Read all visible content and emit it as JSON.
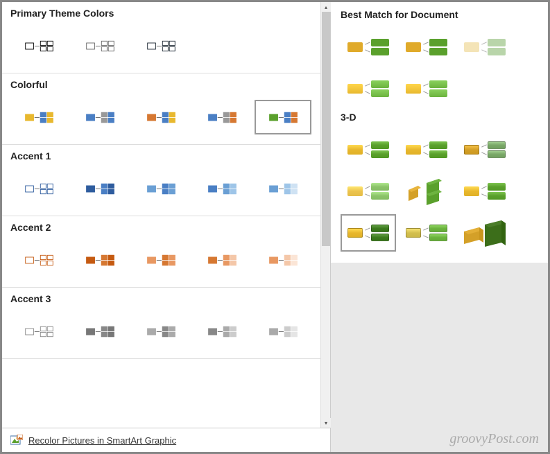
{
  "left_panel": {
    "sections": [
      {
        "id": "primary",
        "title": "Primary Theme Colors",
        "items": [
          {
            "c1": "#fff",
            "c2": "#fff",
            "c3": "#fff",
            "border": "#000"
          },
          {
            "c1": "#fff",
            "c2": "#333",
            "c3": "#fff",
            "border": "#666"
          },
          {
            "c1": "#2c3e50",
            "c2": "#34495e",
            "c3": "#2c3e50",
            "border": "#1a2530"
          }
        ]
      },
      {
        "id": "colorful",
        "title": "Colorful",
        "items": [
          {
            "c1": "#e8b82e",
            "c2": "#4a7fc4",
            "c3": "#e8b82e",
            "border": "transparent"
          },
          {
            "c1": "#4a7fc4",
            "c2": "#999",
            "c3": "#4a7fc4",
            "border": "transparent"
          },
          {
            "c1": "#d67832",
            "c2": "#4a7fc4",
            "c3": "#e8b82e",
            "border": "transparent"
          },
          {
            "c1": "#4a7fc4",
            "c2": "#999",
            "c3": "#d67832",
            "border": "transparent"
          },
          {
            "c1": "#5aa02c",
            "c2": "#4a7fc4",
            "c3": "#d67832",
            "border": "transparent",
            "selected": true
          }
        ]
      },
      {
        "id": "accent1",
        "title": "Accent 1",
        "items": [
          {
            "c1": "#fff",
            "c2": "#fff",
            "c3": "#fff",
            "border": "#2e5c9e"
          },
          {
            "c1": "#2e5c9e",
            "c2": "#4a7fc4",
            "c3": "#2e5c9e",
            "border": "transparent"
          },
          {
            "c1": "#6a9fd4",
            "c2": "#4a7fc4",
            "c3": "#6a9fd4",
            "border": "transparent"
          },
          {
            "c1": "#4a7fc4",
            "c2": "#6a9fd4",
            "c3": "#9ec5e8",
            "border": "transparent"
          },
          {
            "c1": "#6a9fd4",
            "c2": "#9ec5e8",
            "c3": "#cfe2f3",
            "border": "transparent"
          }
        ]
      },
      {
        "id": "accent2",
        "title": "Accent 2",
        "items": [
          {
            "c1": "#fff",
            "c2": "#fff",
            "c3": "#fff",
            "border": "#c55a11"
          },
          {
            "c1": "#c55a11",
            "c2": "#d67832",
            "c3": "#c55a11",
            "border": "transparent"
          },
          {
            "c1": "#e89862",
            "c2": "#d67832",
            "c3": "#e89862",
            "border": "transparent"
          },
          {
            "c1": "#d67832",
            "c2": "#e89862",
            "c3": "#f4c7a8",
            "border": "transparent"
          },
          {
            "c1": "#e89862",
            "c2": "#f4c7a8",
            "c3": "#fbe5d6",
            "border": "transparent"
          }
        ]
      },
      {
        "id": "accent3",
        "title": "Accent 3",
        "items": [
          {
            "c1": "#fff",
            "c2": "#fff",
            "c3": "#fff",
            "border": "#888"
          },
          {
            "c1": "#777",
            "c2": "#888",
            "c3": "#777",
            "border": "transparent"
          },
          {
            "c1": "#aaa",
            "c2": "#888",
            "c3": "#aaa",
            "border": "transparent"
          },
          {
            "c1": "#888",
            "c2": "#aaa",
            "c3": "#ccc",
            "border": "transparent"
          },
          {
            "c1": "#aaa",
            "c2": "#ccc",
            "c3": "#e5e5e5",
            "border": "transparent"
          }
        ]
      }
    ],
    "footer": {
      "link_text": "Recolor Pictures in SmartArt Graphic",
      "accesskey_underline": "R"
    }
  },
  "right_panel": {
    "sections": [
      {
        "title": "Best Match for Document",
        "rows": [
          [
            {
              "yellow": "#e0aa2a",
              "green": "#5aa02c"
            },
            {
              "yellow": "#e0aa2a",
              "green": "#5aa02c"
            },
            {
              "yellow": "#f0d99a",
              "green": "#9cc487",
              "faded": true
            }
          ],
          [
            {
              "yellow": "#e8b82e",
              "green": "#6cb33f",
              "gloss": true
            },
            {
              "yellow": "#e8b82e",
              "green": "#6cb33f",
              "gloss": true
            }
          ]
        ]
      },
      {
        "title": "3-D",
        "rows": [
          [
            {
              "type": "gloss",
              "yellow": "#e8b82e",
              "green": "#5aa02c"
            },
            {
              "type": "gloss",
              "yellow": "#e8b82e",
              "green": "#5aa02c"
            },
            {
              "type": "flat3d",
              "yellow": "#d4a028",
              "green": "#7aa868"
            }
          ],
          [
            {
              "type": "bevel",
              "yellow": "#ecc44e",
              "green": "#8cc46a"
            },
            {
              "type": "iso",
              "yellow": "#d4a028",
              "green": "#5aa02c"
            },
            {
              "type": "bevel",
              "yellow": "#e8b82e",
              "green": "#5aa02c"
            }
          ],
          [
            {
              "type": "crystal",
              "yellow": "#e8b82e",
              "green": "#3c7a1e",
              "selected": true
            },
            {
              "type": "crystal",
              "yellow": "#d4c050",
              "green": "#6cb33f"
            },
            {
              "type": "block",
              "yellow": "#d4a028",
              "green": "#3c6e1a"
            }
          ]
        ]
      }
    ]
  },
  "watermark": "groovyPost.com"
}
